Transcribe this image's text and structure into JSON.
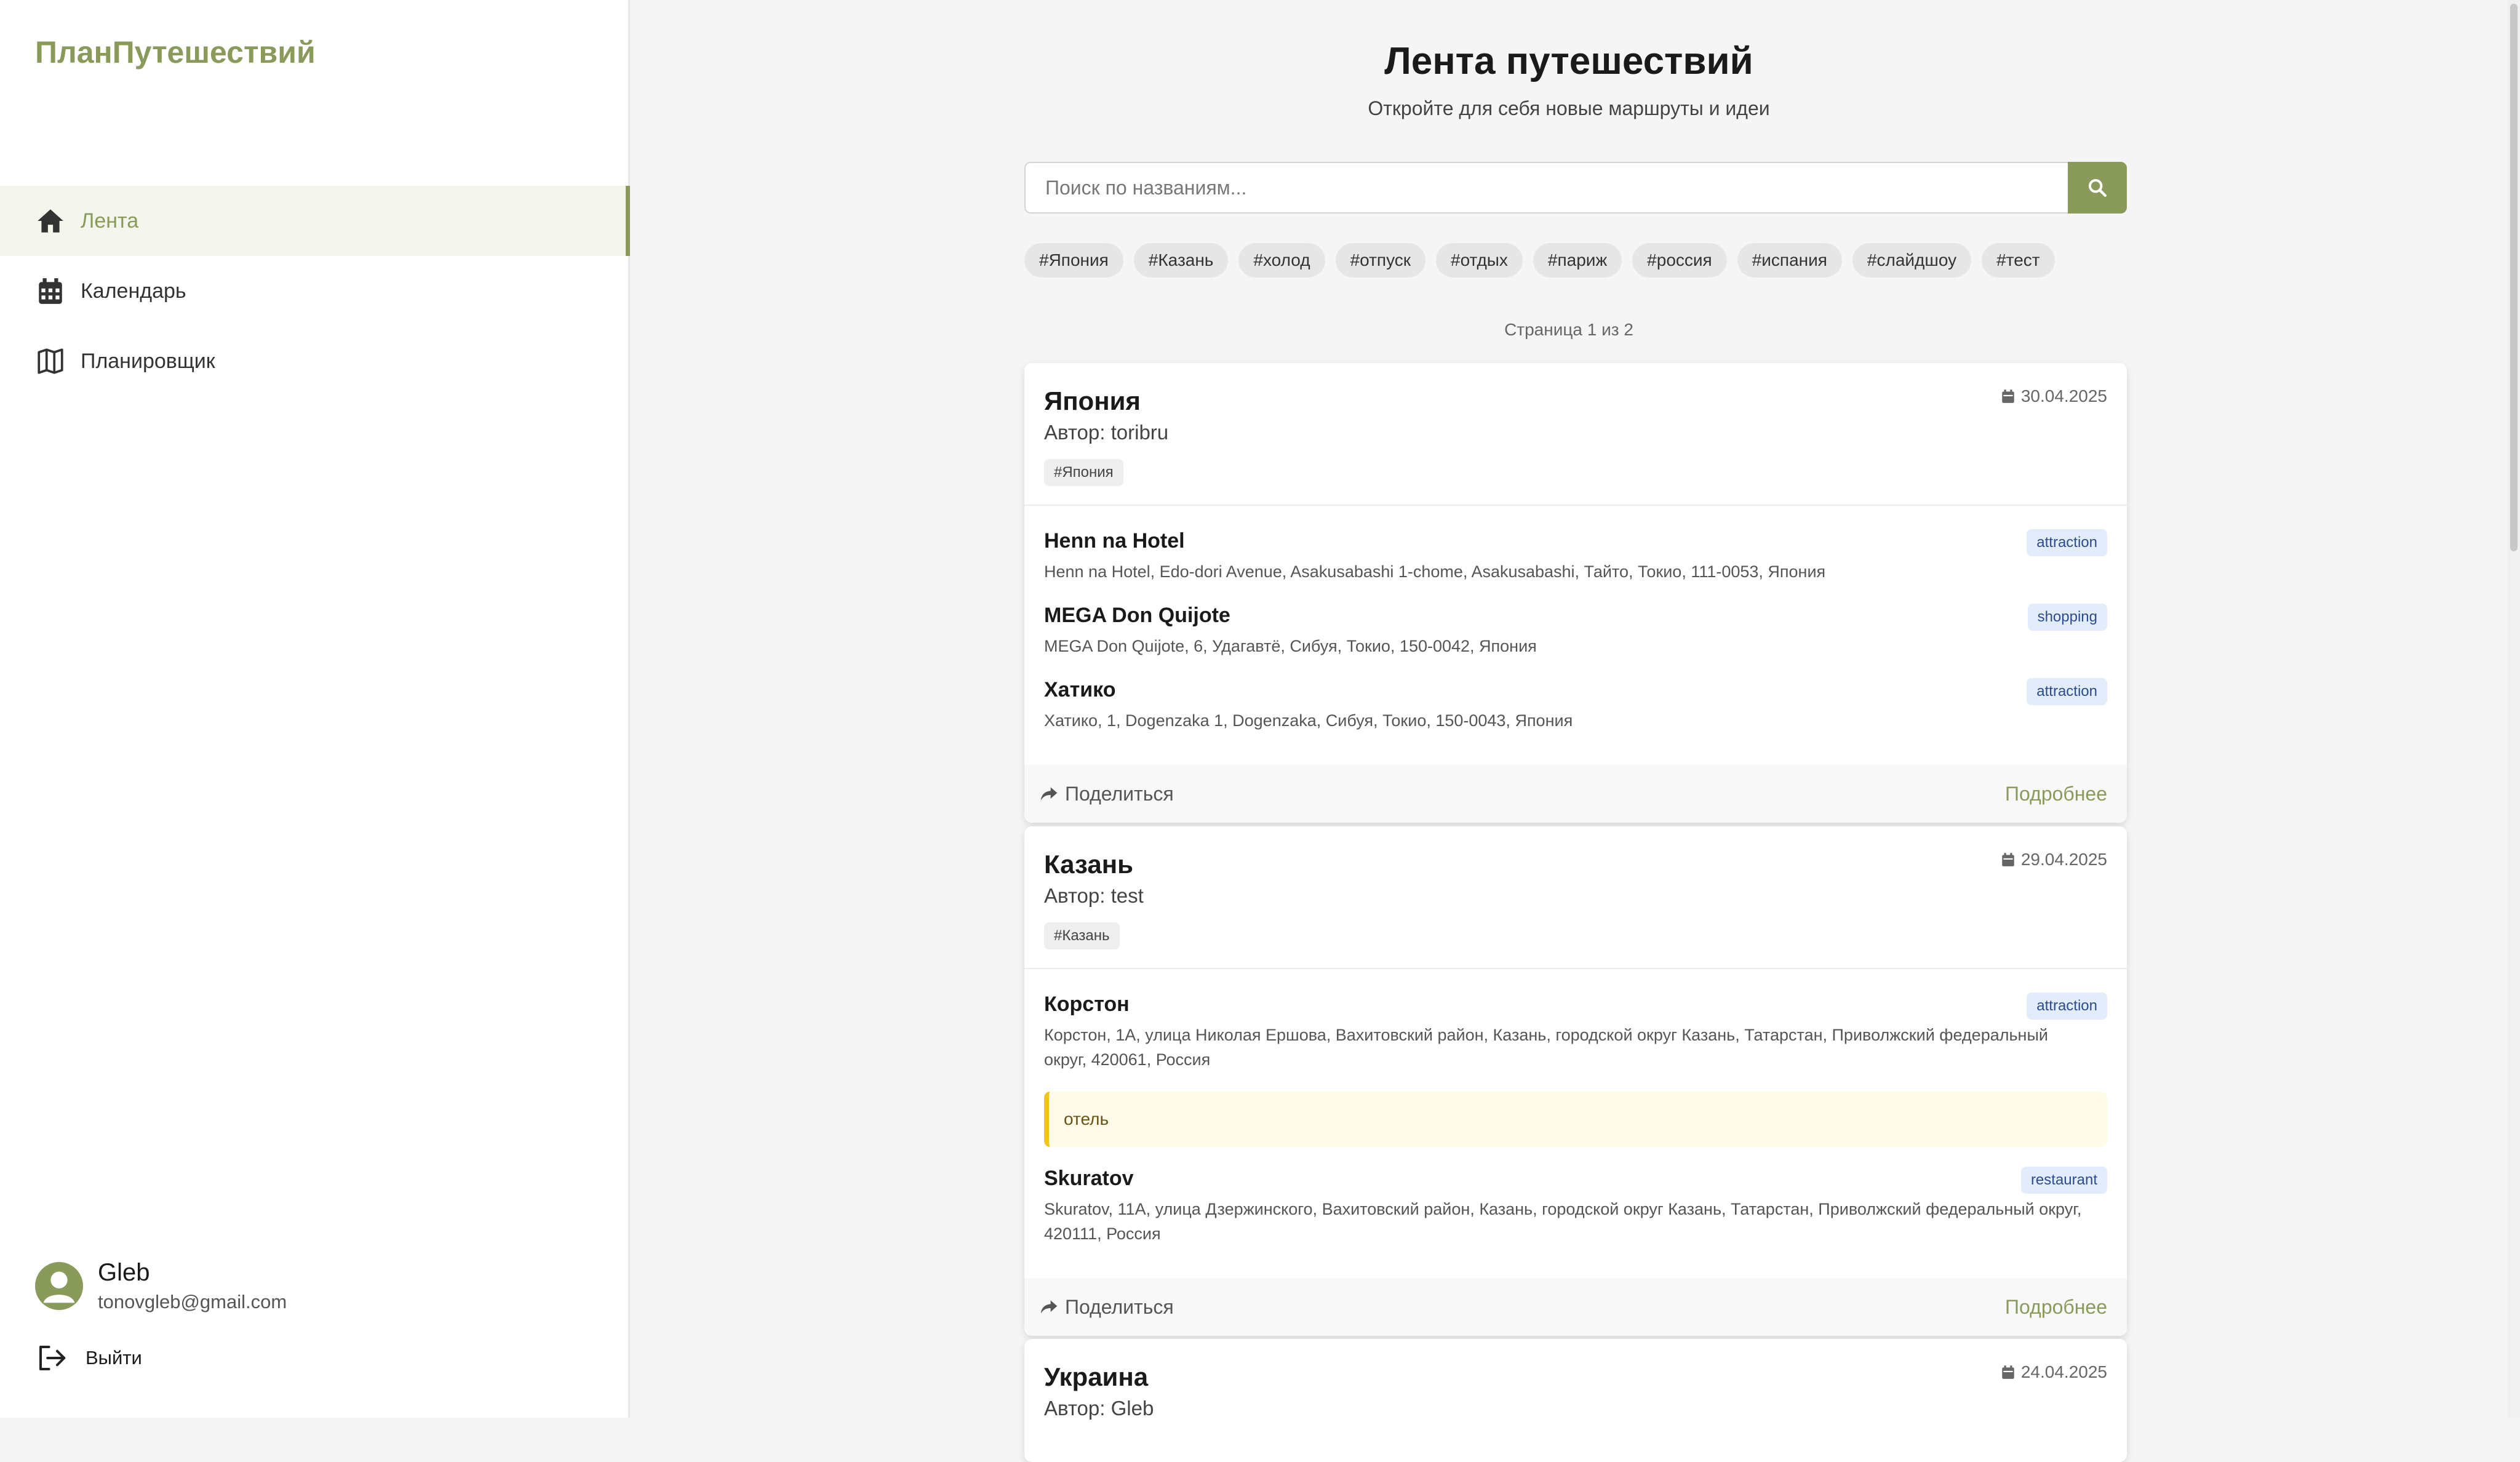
{
  "brand": "ПланПутешествий",
  "nav": [
    {
      "label": "Лента",
      "icon": "home-icon",
      "active": true
    },
    {
      "label": "Календарь",
      "icon": "calendar-icon",
      "active": false
    },
    {
      "label": "Планировщик",
      "icon": "map-icon",
      "active": false
    }
  ],
  "user": {
    "name": "Gleb",
    "email": "tonovgleb@gmail.com",
    "logout_label": "Выйти"
  },
  "header": {
    "title": "Лента путешествий",
    "subtitle": "Откройте для себя новые маршруты и идеи"
  },
  "search": {
    "placeholder": "Поиск по названиям...",
    "value": ""
  },
  "tags": [
    "#Япония",
    "#Казань",
    "#холод",
    "#отпуск",
    "#отдых",
    "#париж",
    "#россия",
    "#испания",
    "#слайдшоу",
    "#тест"
  ],
  "page_info": "Страница 1 из 2",
  "posts": [
    {
      "title": "Япония",
      "author": "Автор: toribru",
      "tag": "#Япония",
      "date": "30.04.2025",
      "places": [
        {
          "name": "Henn na Hotel",
          "address": "Henn na Hotel, Edo-dori Avenue, Asakusabashi 1-chome, Asakusabashi, Тайто, Токио, 111-0053, Япония",
          "type": "attraction"
        },
        {
          "name": "MEGA Don Quijote",
          "address": "MEGA Don Quijote, 6, Удагавтё, Сибуя, Токио, 150-0042, Япония",
          "type": "shopping"
        },
        {
          "name": "Хатико",
          "address": "Хатико, 1, Dogenzaka 1, Dogenzaka, Сибуя, Токио, 150-0043, Япония",
          "type": "attraction"
        }
      ],
      "share_label": "Поделиться",
      "more_label": "Подробнее"
    },
    {
      "title": "Казань",
      "author": "Автор: test",
      "tag": "#Казань",
      "date": "29.04.2025",
      "places": [
        {
          "name": "Корстон",
          "address": "Корстон, 1А, улица Николая Ершова, Вахитовский район, Казань, городской округ Казань, Татарстан, Приволжский федеральный округ, 420061, Россия",
          "type": "attraction",
          "note": "отель"
        },
        {
          "name": "Skuratov",
          "address": "Skuratov, 11А, улица Дзержинского, Вахитовский район, Казань, городской округ Казань, Татарстан, Приволжский федеральный округ, 420111, Россия",
          "type": "restaurant"
        }
      ],
      "share_label": "Поделиться",
      "more_label": "Подробнее"
    },
    {
      "title": "Украина",
      "author": "Автор: Gleb",
      "date": "24.04.2025"
    }
  ],
  "colors": {
    "accent": "#8a9a5b",
    "badge_bg": "#e3ecfb",
    "note_border": "#f2c31b"
  }
}
